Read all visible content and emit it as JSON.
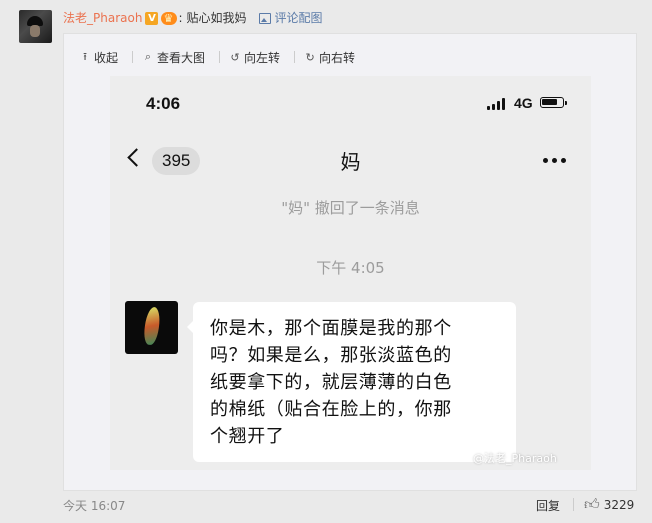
{
  "comment": {
    "username": "法老_Pharaoh",
    "separator": ":",
    "text": "贴心如我妈",
    "pic_link_label": "评论配图"
  },
  "toolbar": {
    "collapse_label": "收起",
    "view_large_label": "查看大图",
    "rotate_left_label": "向左转",
    "rotate_right_label": "向右转"
  },
  "screenshot": {
    "status_time": "4:06",
    "network": "4G",
    "unread_count": "395",
    "chat_title": "妈",
    "recall_notice": "\"妈\" 撤回了一条消息",
    "timestamp": "下午 4:05",
    "message_lines": [
      "你是木，那个面膜是我的那个",
      "吗？如果是么，那张淡蓝色的",
      "纸要拿下的，就层薄薄的白色",
      "的棉纸（贴合在脸上的，你那",
      "个翘开了"
    ],
    "watermark": "@法老_Pharaoh"
  },
  "footer": {
    "time": "今天 16:07",
    "reply_label": "回复",
    "like_count": "3229"
  }
}
